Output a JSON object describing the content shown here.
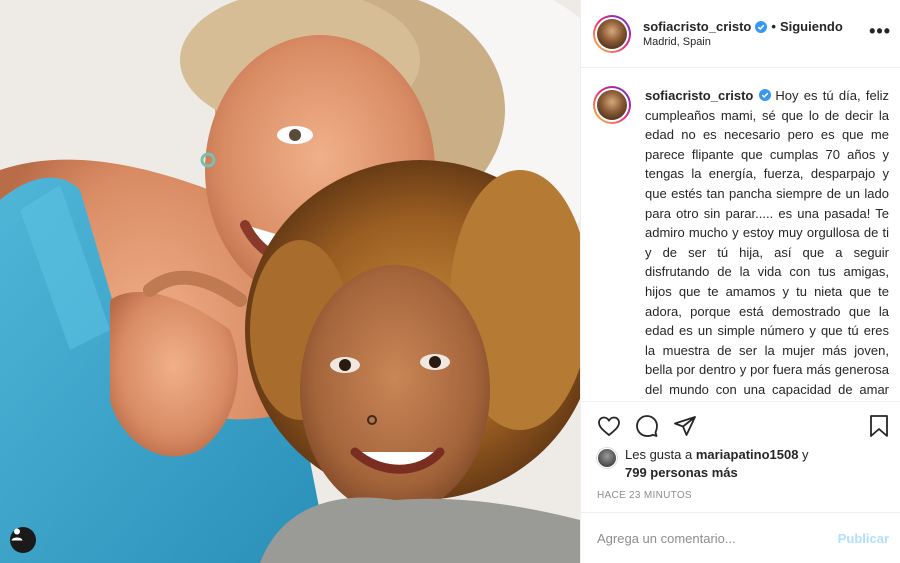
{
  "post": {
    "username": "sofiacristo_cristo",
    "follow_label": "Siguiendo",
    "separator": "•",
    "location": "Madrid, Spain",
    "more_label": "•••",
    "verified_color": "#3897f0"
  },
  "caption": {
    "username": "sofiacristo_cristo",
    "text": "Hoy es tú día, feliz cumpleaños mami, sé que lo de decir la edad no es necesario pero es que me parece flipante que cumplas 70 años y tengas la energía, fuerza, desparpajo y que estés tan pancha siempre de un lado para otro sin parar..... es una pasada! Te admiro mucho y estoy muy orgullosa de ti y de ser tú hija, así que a seguir disfrutando de la vida con tus amigas, hijos que te amamos y tu nieta que te adora, porque está demostrado que la edad es un simple número y que tú eres la muestra de ser la mujer más joven, bella por dentro y por fuera más generosa del mundo con una capacidad de amar infinita, por eso todo el que se acerca a ti te ama",
    "emoji": "❤️"
  },
  "actions": {
    "like_icon": "heart-outline-icon",
    "comment_icon": "comment-bubble-icon",
    "share_icon": "paper-plane-icon",
    "save_icon": "bookmark-icon"
  },
  "likes": {
    "prefix": "Les gusta a ",
    "user": "mariapatino1508",
    "connector": " y",
    "others": "799 personas más"
  },
  "timestamp": "Hace 23 minutos",
  "comment": {
    "placeholder": "Agrega un comentario...",
    "publish_label": "Publicar"
  },
  "photo": {
    "tag_icon": "user-tag-icon"
  }
}
